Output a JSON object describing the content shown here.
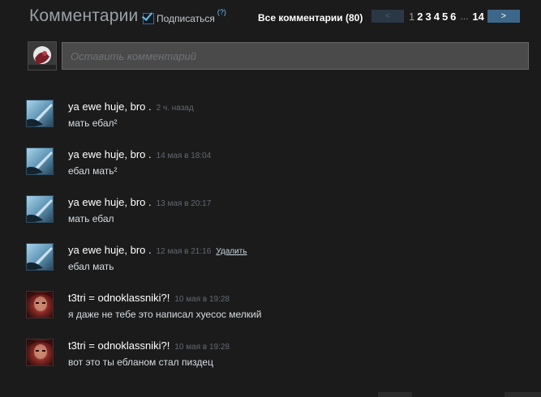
{
  "header": {
    "title": "Комментарии",
    "subscribe_label": "Подписаться",
    "subscribe_count": "(?)",
    "all_comments_label": "Все комментарии (80)"
  },
  "pager": {
    "prev": "<",
    "next": ">",
    "pages": [
      "1",
      "2",
      "3",
      "4",
      "5",
      "6"
    ],
    "ellipsis": "...",
    "last": "14",
    "current": "1"
  },
  "input": {
    "placeholder": "Оставить комментарий"
  },
  "comments": [
    {
      "author": "ya ewe huje, bro .",
      "time": "2 ч. назад",
      "text": "мать ебал²",
      "avatar": "blue-sky-avatar"
    },
    {
      "author": "ya ewe huje, bro .",
      "time": "14 мая в 18:04",
      "text": "ебал мать²",
      "avatar": "blue-sky-avatar"
    },
    {
      "author": "ya ewe huje, bro .",
      "time": "13 мая в 20:17",
      "text": "мать ебал",
      "avatar": "blue-sky-avatar"
    },
    {
      "author": "ya ewe huje, bro .",
      "time": "12 мая в 21:16",
      "text": "ебал мать",
      "delete": "Удалить",
      "avatar": "blue-sky-avatar"
    },
    {
      "author": "t3tri = odnoklassniki?!",
      "time": "10 мая в 19:28",
      "text": "я даже не тебе это написал хуесос мелкий",
      "avatar": "red-face-avatar"
    },
    {
      "author": "t3tri = odnoklassniki?!",
      "time": "10 мая в 19:28",
      "text": "вот это ты ебланом стал пиздец",
      "avatar": "red-face-avatar"
    }
  ],
  "colors": {
    "background": "#1b1b1c",
    "link_blue": "#67c1f5",
    "next_button": "#3c6789",
    "timestamp": "#626a72"
  }
}
